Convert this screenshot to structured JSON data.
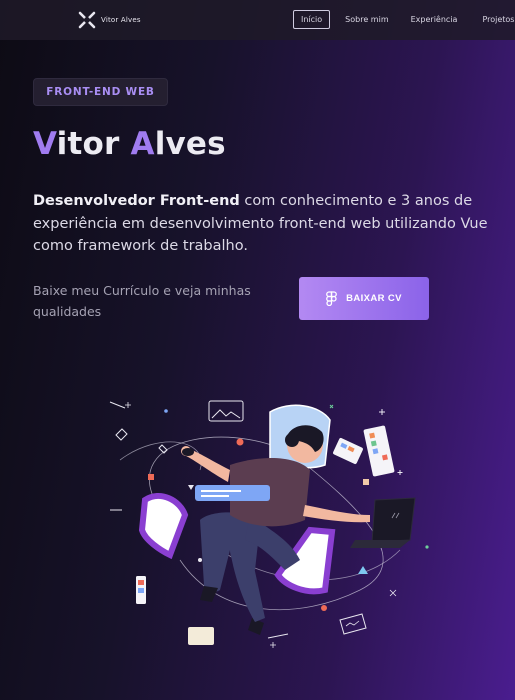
{
  "navbar": {
    "brand": "Vitor Alves",
    "links": [
      {
        "label": "Início",
        "active": true
      },
      {
        "label": "Sobre mim",
        "active": false
      },
      {
        "label": "Experiência",
        "active": false
      },
      {
        "label": "Projetos",
        "active": false
      }
    ]
  },
  "hero": {
    "badge": "FRONT-END WEB",
    "name_initial_1": "V",
    "name_rest_1": "itor ",
    "name_initial_2": "A",
    "name_rest_2": "lves",
    "role": "Desenvolvedor Front-end",
    "description": " com conhecimento e 3 anos de experiência em desenvolvimento front-end web utilizando Vue como framework de trabalho.",
    "cv_text": "Baixe meu Currículo e veja minhas qualidades",
    "cv_button": "BAIXAR CV"
  },
  "colors": {
    "accent": "#a07cf0",
    "button_start": "#b389f2",
    "button_end": "#8b63e9",
    "background_dark": "#0d0b14",
    "background_purple": "#4a1d8f"
  },
  "icons": {
    "logo": "x-logo-icon",
    "button": "figma-icon",
    "illustration": "developer-illustration"
  }
}
